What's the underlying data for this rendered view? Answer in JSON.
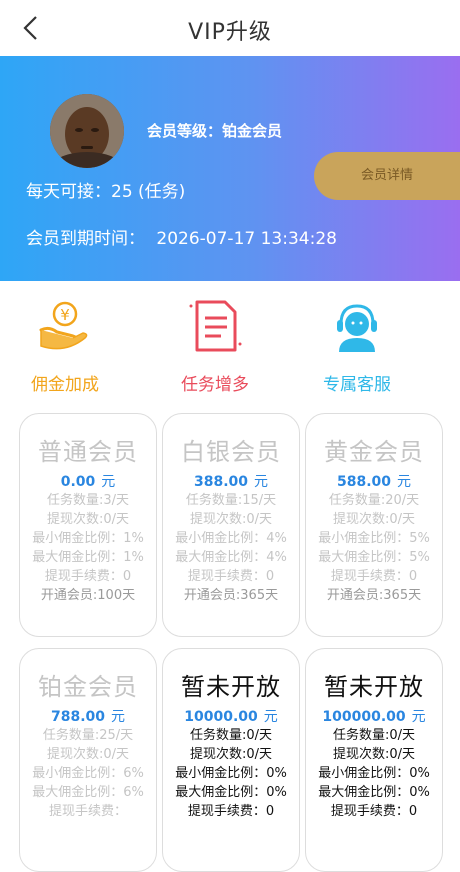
{
  "header": {
    "title": "VIP升级"
  },
  "banner": {
    "level_text": "会员等级：铂金会员",
    "daily_text": "每天可接：25 (任务)",
    "expire_label": "会员到期时间：",
    "expire_value": "2026-07-17 13:34:28",
    "detail_button": "会员详情"
  },
  "features": [
    {
      "label": "佣金加成",
      "icon": "money-hand-icon",
      "color": "#f2a51c"
    },
    {
      "label": "任务增多",
      "icon": "task-document-icon",
      "color": "#e94b5b"
    },
    {
      "label": "专属客服",
      "icon": "customer-service-icon",
      "color": "#2fb8e8"
    }
  ],
  "cards": [
    {
      "name": "普通会员",
      "price": "0.00",
      "unit": "元",
      "rows": [
        "任务数量:3/天",
        "提现次数:0/天",
        "最小佣金比例：1%",
        "最大佣金比例：1%",
        "提现手续费：0",
        "开通会员:100天"
      ]
    },
    {
      "name": "白银会员",
      "price": "388.00",
      "unit": "元",
      "rows": [
        "任务数量:15/天",
        "提现次数:0/天",
        "最小佣金比例：4%",
        "最大佣金比例：4%",
        "提现手续费：0",
        "开通会员:365天"
      ]
    },
    {
      "name": "黄金会员",
      "price": "588.00",
      "unit": "元",
      "rows": [
        "任务数量:20/天",
        "提现次数:0/天",
        "最小佣金比例：5%",
        "最大佣金比例：5%",
        "提现手续费：0",
        "开通会员:365天"
      ]
    },
    {
      "name": "铂金会员",
      "price": "788.00",
      "unit": "元",
      "rows": [
        "任务数量:25/天",
        "提现次数:0/天",
        "最小佣金比例：6%",
        "最大佣金比例：6%",
        "提现手续费："
      ]
    },
    {
      "name": "暂未开放",
      "price": "10000.00",
      "unit": "元",
      "rows": [
        "任务数量:0/天",
        "提现次数:0/天",
        "最小佣金比例：0%",
        "最大佣金比例：0%",
        "提现手续费：0"
      ]
    },
    {
      "name": "暂未开放",
      "price": "100000.00",
      "unit": "元",
      "rows": [
        "任务数量:0/天",
        "提现次数:0/天",
        "最小佣金比例：0%",
        "最大佣金比例：0%",
        "提现手续费：0"
      ]
    }
  ]
}
